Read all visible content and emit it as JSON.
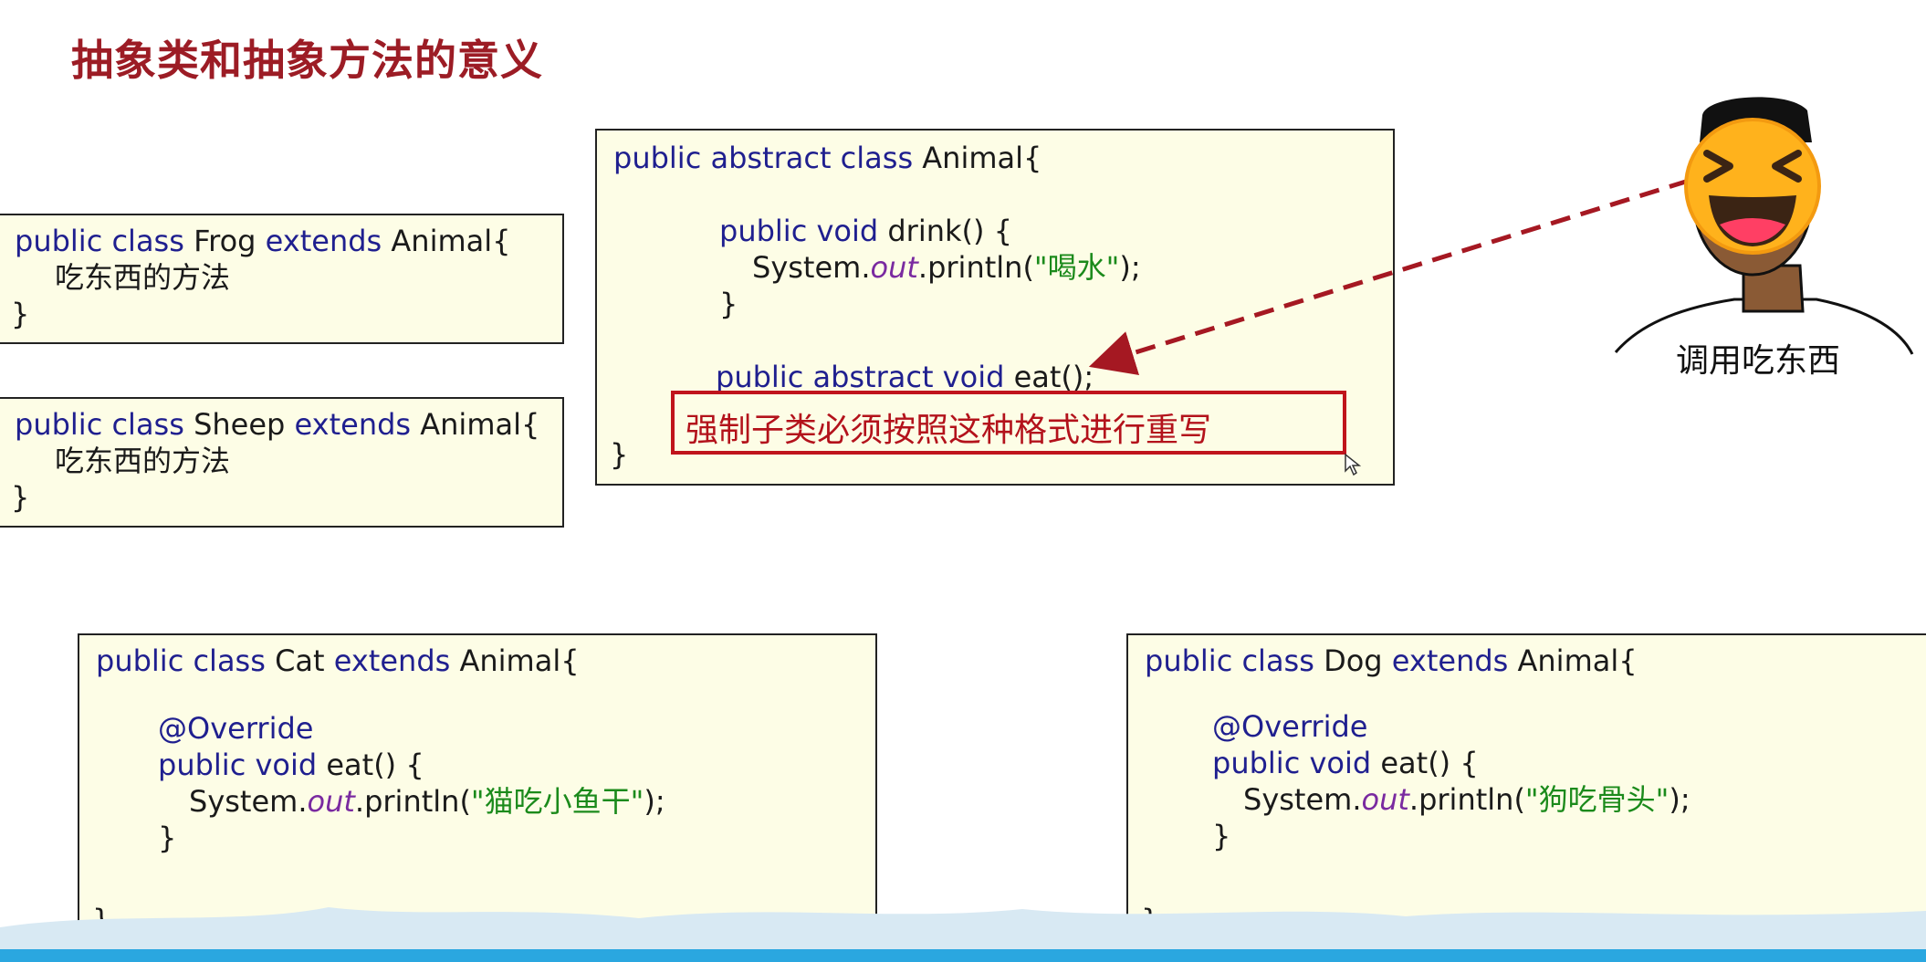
{
  "page": {
    "title": "抽象类和抽象方法的意义"
  },
  "animal": {
    "l1_kw": "public abstract class",
    "l1_name": " Animal{",
    "l2_kw": "public void",
    "l2_rest": " drink() {",
    "l3_a": "System.",
    "l3_b": "out",
    "l3_c": ".println(",
    "l3_str": "\"喝水\"",
    "l3_d": ");",
    "l4": "}",
    "l5_kw": "public abstract void",
    "l5_rest": " eat();",
    "l6": "}"
  },
  "note": {
    "text": "强制子类必须按照这种格式进行重写"
  },
  "frog": {
    "kw1": "public class",
    "name": " Frog ",
    "kw2": "extends",
    "rest": " Animal{",
    "body": "吃东西的方法",
    "close": "}"
  },
  "sheep": {
    "kw1": "public class",
    "name": " Sheep ",
    "kw2": "extends",
    "rest": " Animal{",
    "body": "吃东西的方法",
    "close": "}"
  },
  "cat": {
    "kw1": "public class",
    "name": " Cat ",
    "kw2": "extends",
    "rest": " Animal{",
    "annot": "@Override",
    "m_kw": "public void",
    "m_rest": " eat() {",
    "s_a": "System.",
    "s_b": "out",
    "s_c": ".println(",
    "s_str": "\"猫吃小鱼干\"",
    "s_d": ");",
    "close_m": "}",
    "close": "}"
  },
  "dog": {
    "kw1": "public class",
    "name": " Dog ",
    "kw2": "extends",
    "rest": " Animal{",
    "annot": "@Override",
    "m_kw": "public void",
    "m_rest": " eat() {",
    "s_a": "System.",
    "s_b": "out",
    "s_c": ".println(",
    "s_str": "\"狗吃骨头\"",
    "s_d": ");",
    "close_m": "}",
    "close": "}"
  },
  "person": {
    "caption": "调用吃东西"
  },
  "colors": {
    "title": "#9c1c25",
    "keyword": "#1f1f8f",
    "string": "#1b8a1b",
    "note_border": "#c0141c",
    "arrow": "#a51822"
  }
}
